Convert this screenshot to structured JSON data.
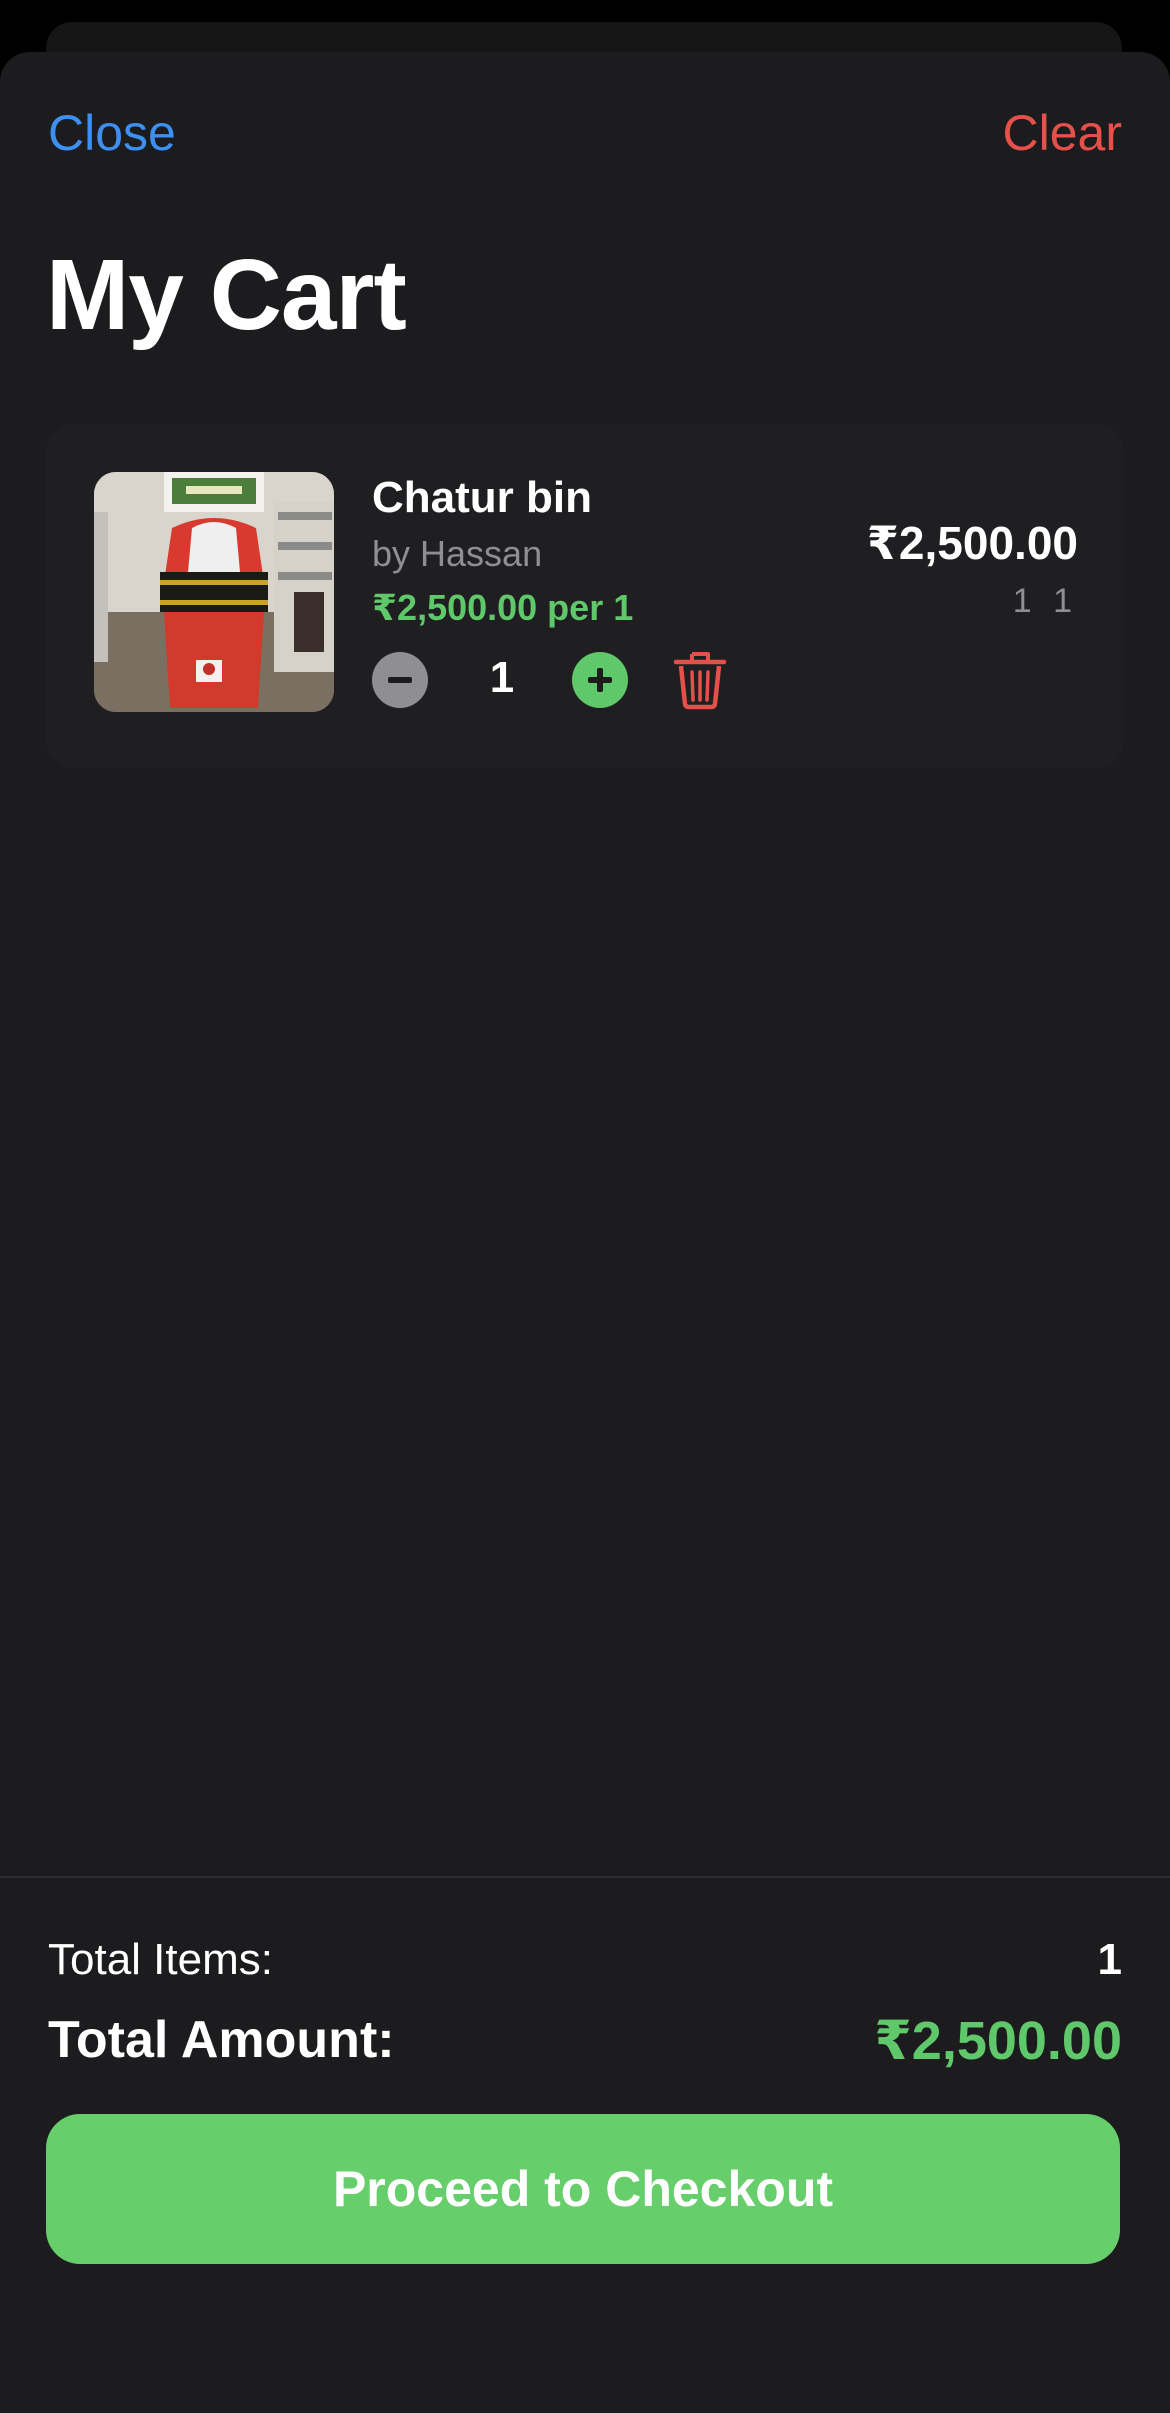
{
  "nav": {
    "close_label": "Close",
    "clear_label": "Clear"
  },
  "page": {
    "title": "My Cart"
  },
  "cart": {
    "items": [
      {
        "name": "Chatur bin",
        "seller": "by Hassan",
        "unit_price": "₹2,500.00 per 1",
        "quantity": "1",
        "line_total": "₹2,500.00",
        "line_sub": "1 1",
        "image_icon": "product-photo-red-dustbin"
      }
    ]
  },
  "summary": {
    "total_items_label": "Total Items:",
    "total_items_value": "1",
    "total_amount_label": "Total Amount:",
    "total_amount_value": "₹2,500.00"
  },
  "checkout": {
    "label": "Proceed to Checkout"
  },
  "colors": {
    "background": "#1c1c1e",
    "link_blue": "#3d8ff0",
    "destructive_red": "#e5504a",
    "accent_green": "#5fc86a",
    "checkout_green": "#66ce6a",
    "secondary_gray": "#8e8e93"
  },
  "icons": {
    "minus": "minus-circle-icon",
    "plus": "plus-circle-icon",
    "trash": "trash-icon"
  }
}
